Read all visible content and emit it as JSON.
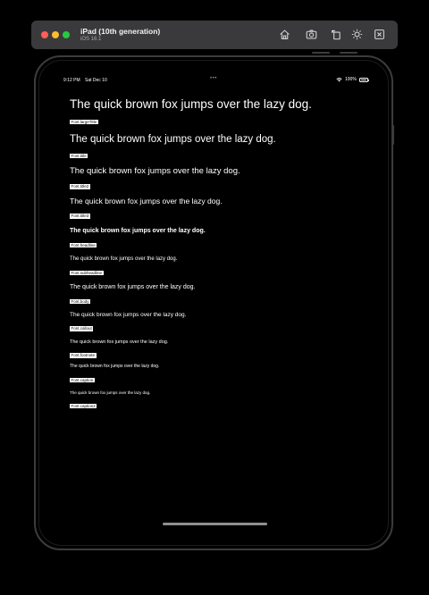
{
  "simulator": {
    "device_name": "iPad (10th generation)",
    "os_version": "iOS 16.1",
    "toolbar_icons": [
      "home-icon",
      "screenshot-icon",
      "rotate-icon",
      "appearance-icon",
      "close-icon"
    ]
  },
  "status_bar": {
    "time": "9:12 PM",
    "date": "Sat Dec 10",
    "multitasking": "•••",
    "battery": "100%"
  },
  "samples": [
    {
      "text": "The quick brown fox jumps over the lazy dog.",
      "label": "Font.largeTitle"
    },
    {
      "text": "The quick brown fox jumps over the lazy dog.",
      "label": "Font.title"
    },
    {
      "text": "The quick brown fox jumps over the lazy dog.",
      "label": "Font.title2"
    },
    {
      "text": "The quick brown fox jumps over the lazy dog.",
      "label": "Font.title3"
    },
    {
      "text": "The quick brown fox jumps over the lazy dog.",
      "label": "Font.headline"
    },
    {
      "text": "The quick brown fox jumps over the lazy dog.",
      "label": "Font.subheadline"
    },
    {
      "text": "The quick brown fox jumps over the lazy dog.",
      "label": "Font.body"
    },
    {
      "text": "The quick brown fox jumps over the lazy dog.",
      "label": "Font.callout"
    },
    {
      "text": "The quick brown fox jumps over the lazy dog.",
      "label": "Font.footnote"
    },
    {
      "text": "The quick brown fox jumps over the lazy dog.",
      "label": "Font.caption"
    },
    {
      "text": "The quick brown fox jumps over the lazy dog.",
      "label": "Font.caption2"
    }
  ]
}
